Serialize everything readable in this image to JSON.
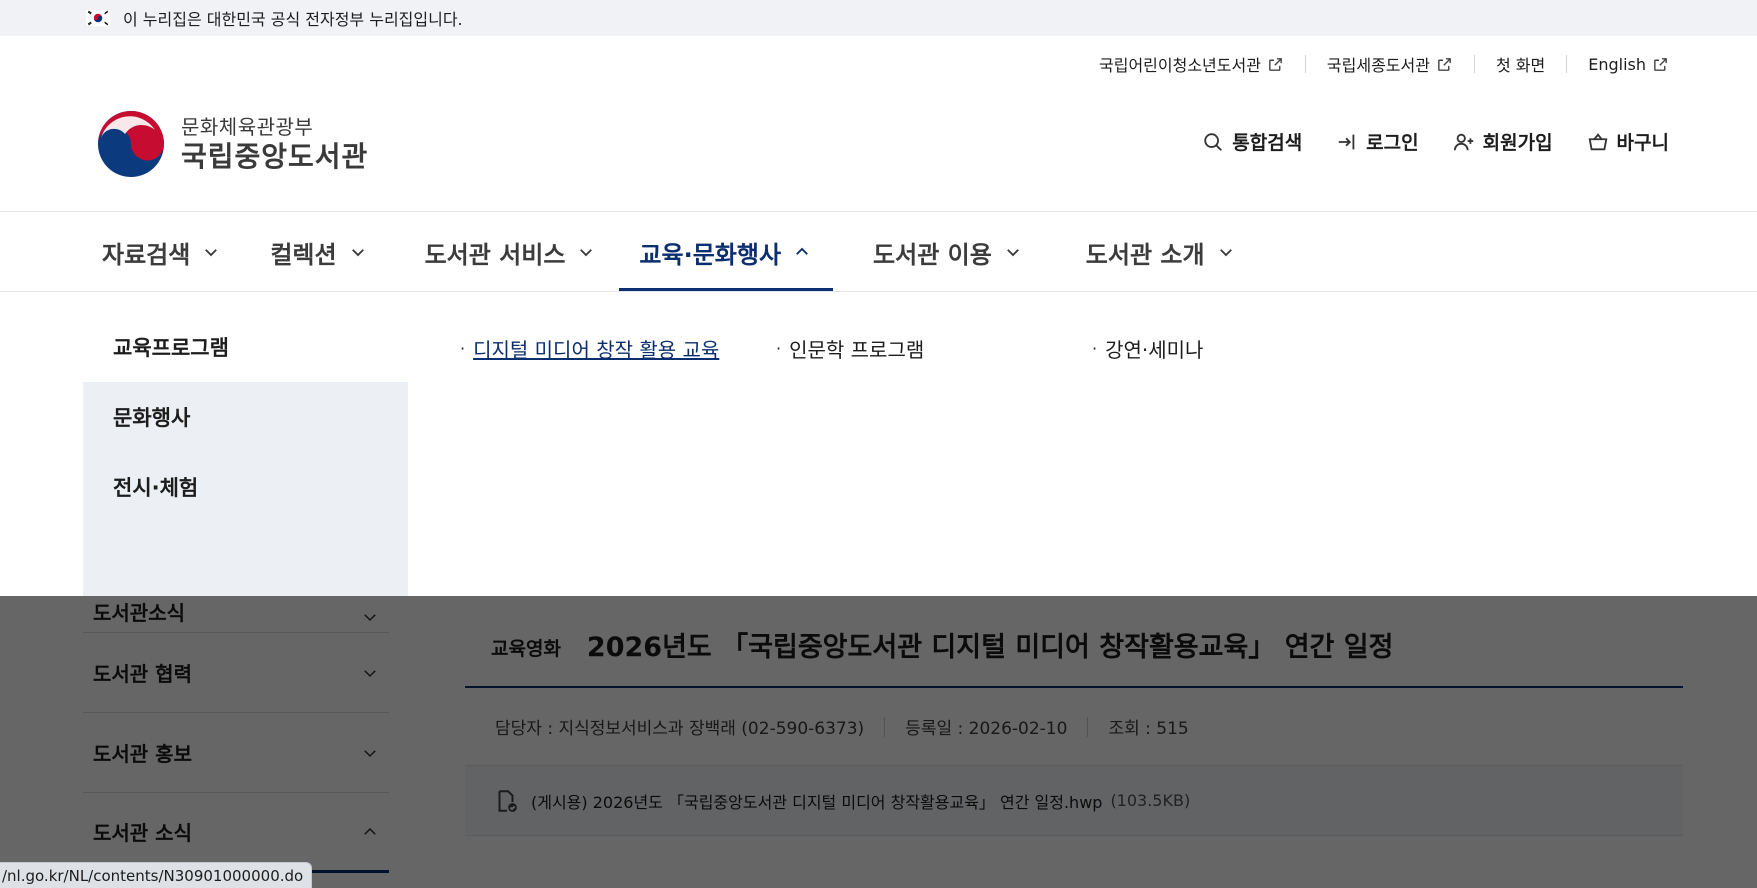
{
  "gov_banner": {
    "text": "이 누리집은 대한민국 공식 전자정부 누리집입니다."
  },
  "utility_links": [
    {
      "label": "국립어린이청소년도서관",
      "external": true
    },
    {
      "label": "국립세종도서관",
      "external": true
    },
    {
      "label": "첫 화면",
      "external": false
    },
    {
      "label": "English",
      "external": true
    }
  ],
  "logo": {
    "ministry": "문화체육관광부",
    "name": "국립중앙도서관"
  },
  "header_actions": {
    "search": "통합검색",
    "login": "로그인",
    "signup": "회원가입",
    "cart": "바구니"
  },
  "gnb": [
    {
      "label": "자료검색",
      "active": false
    },
    {
      "label": "컬렉션",
      "active": false
    },
    {
      "label": "도서관 서비스",
      "active": false
    },
    {
      "label": "교육·문화행사",
      "active": true
    },
    {
      "label": "도서관 이용",
      "active": false
    },
    {
      "label": "도서관 소개",
      "active": false
    }
  ],
  "dropdown": {
    "side_items": [
      {
        "label": "교육프로그램",
        "active": true
      },
      {
        "label": "문화행사",
        "active": false
      },
      {
        "label": "전시·체험",
        "active": false
      }
    ],
    "links": [
      {
        "label": "디지털 미디어 창작 활용 교육",
        "active": true
      },
      {
        "label": "인문학 프로그램",
        "active": false
      },
      {
        "label": "강연·세미나",
        "active": false
      }
    ]
  },
  "lnb": [
    {
      "label": "도서관소식"
    },
    {
      "label": "도서관 협력"
    },
    {
      "label": "도서관 홍보"
    },
    {
      "label": "도서관 소식"
    }
  ],
  "article": {
    "category": "교육영화",
    "title": "2026년도 「국립중앙도서관 디지털 미디어 창작활용교육」 연간 일정",
    "meta": {
      "author": "담당자 : 지식정보서비스과 장백래 (02-590-6373)",
      "date": "등록일 : 2026-02-10",
      "views": "조회 : 515"
    },
    "file": {
      "name": "(게시용) 2026년도 「국립중앙도서관 디지털 미디어 창작활용교육」 연간 일정.hwp",
      "size": "(103.5KB)"
    }
  },
  "status_bar": {
    "url": "/nl.go.kr/NL/contents/N30901000000.do"
  },
  "colors": {
    "primary": "#0b2e6e",
    "banner_bg": "#f0f2f5",
    "panel_bg": "#eceff4"
  }
}
